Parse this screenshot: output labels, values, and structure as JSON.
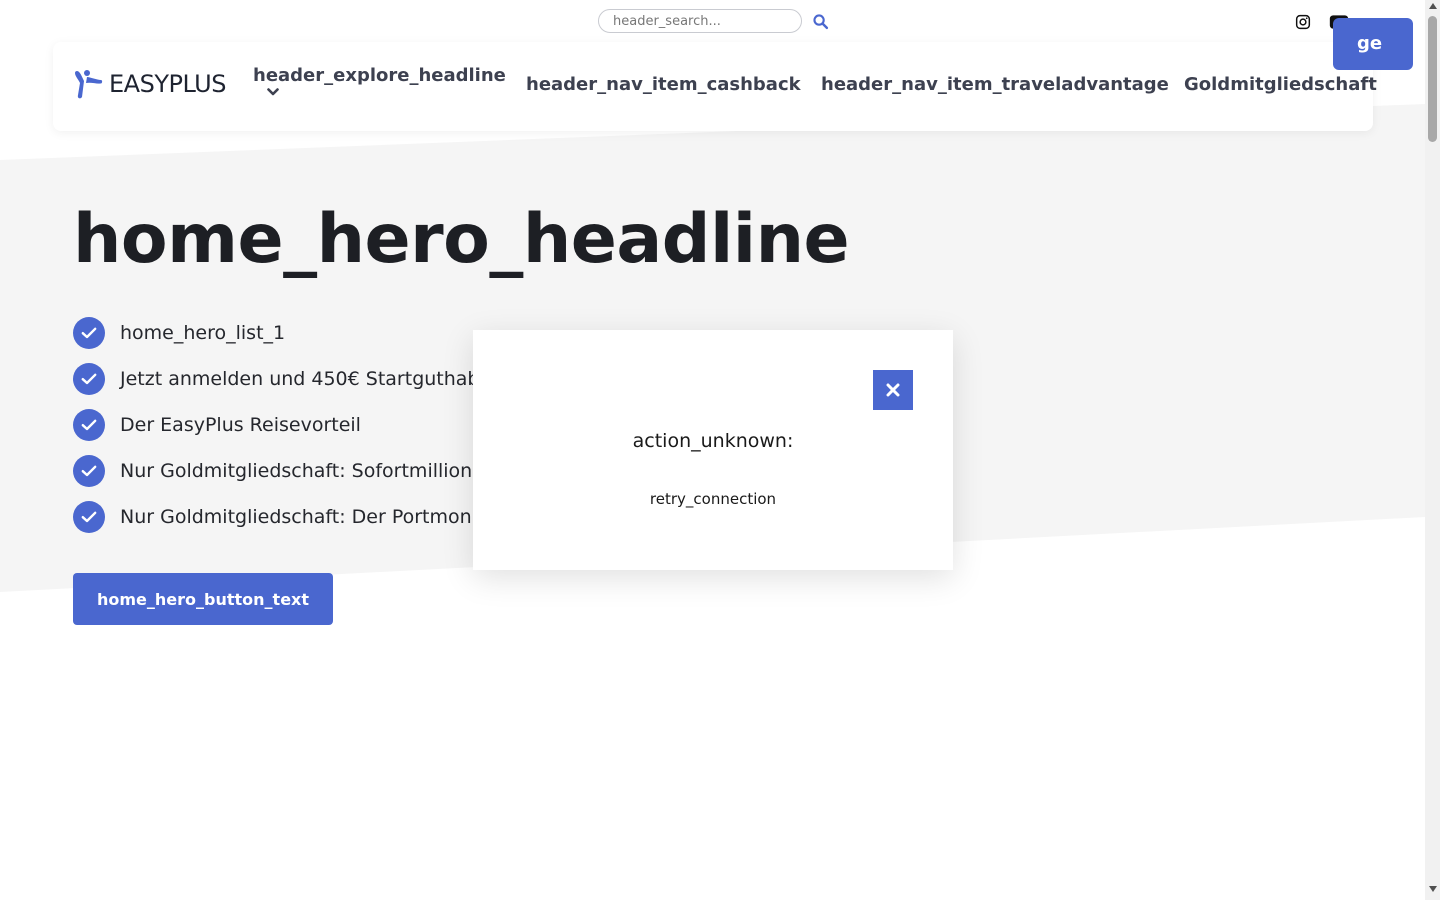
{
  "header": {
    "search_placeholder": "header_search...",
    "logo_text": "EASYPLUS",
    "nav": {
      "explore": "header_explore_headline",
      "cashback": "header_nav_item_cashback",
      "traveladvantage": "header_nav_item_traveladvantage",
      "gold": "Goldmitgliedschaft",
      "cta_partial": "ge"
    }
  },
  "hero": {
    "headline": "home_hero_headline",
    "list": [
      "home_hero_list_1",
      "Jetzt anmelden und 450€ Startguthab",
      "Der EasyPlus Reisevorteil",
      "Nur Goldmitgliedschaft: Sofortmillion",
      "Nur Goldmitgliedschaft: Der Portmon"
    ],
    "button_text": "home_hero_button_text"
  },
  "modal": {
    "title": "action_unknown:",
    "retry": "retry_connection"
  },
  "colors": {
    "accent": "#4a67cf",
    "hero_bg": "#f5f5f5",
    "text_dark": "#1d1f24"
  },
  "icons": {
    "search": "search-icon",
    "instagram": "instagram-icon",
    "youtube": "youtube-icon",
    "check": "check-circle-icon",
    "close": "close-icon",
    "chevron": "chevron-down-icon"
  }
}
